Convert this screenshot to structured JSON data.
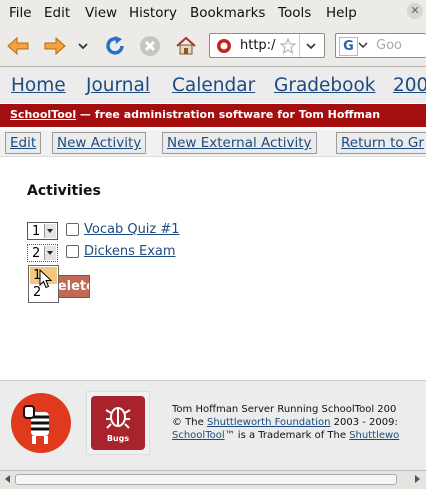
{
  "menu": {
    "file": "File",
    "edit": "Edit",
    "view": "View",
    "history": "History",
    "bookmarks": "Bookmarks",
    "tools": "Tools",
    "help": "Help"
  },
  "toolbar": {
    "url": "http:/",
    "search_placeholder": "Goo"
  },
  "nav": {
    "items": [
      "Home",
      "Journal",
      "Calendar",
      "Gradebook",
      "200"
    ]
  },
  "banner": {
    "brand": "SchoolTool",
    "text": " — free administration software for Tom Hoffman"
  },
  "actions": [
    "Edit",
    "New Activity",
    "New External Activity",
    "Return to Gr"
  ],
  "main": {
    "heading": "Activities",
    "rows": [
      {
        "position": "1",
        "label": "Vocab Quiz #1"
      },
      {
        "position": "2",
        "label": "Dickens Exam"
      }
    ],
    "dropdown_options": [
      "1",
      "2"
    ],
    "delete_label": "Delete"
  },
  "footer": {
    "line1": "Tom Hoffman Server Running SchoolTool 200",
    "line2_prefix": "© The ",
    "line2_link": "Shuttleworth Foundation",
    "line2_suffix": " 2003 - 2009:",
    "line3_link": "SchoolTool",
    "line3_mid": "™ is a Trademark of The ",
    "line3_tail": "Shuttlewo",
    "bugs_label": "Bugs"
  },
  "colors": {
    "banner": "#a50e0e",
    "link": "#1d4b80",
    "highlight": "#f4c781"
  }
}
